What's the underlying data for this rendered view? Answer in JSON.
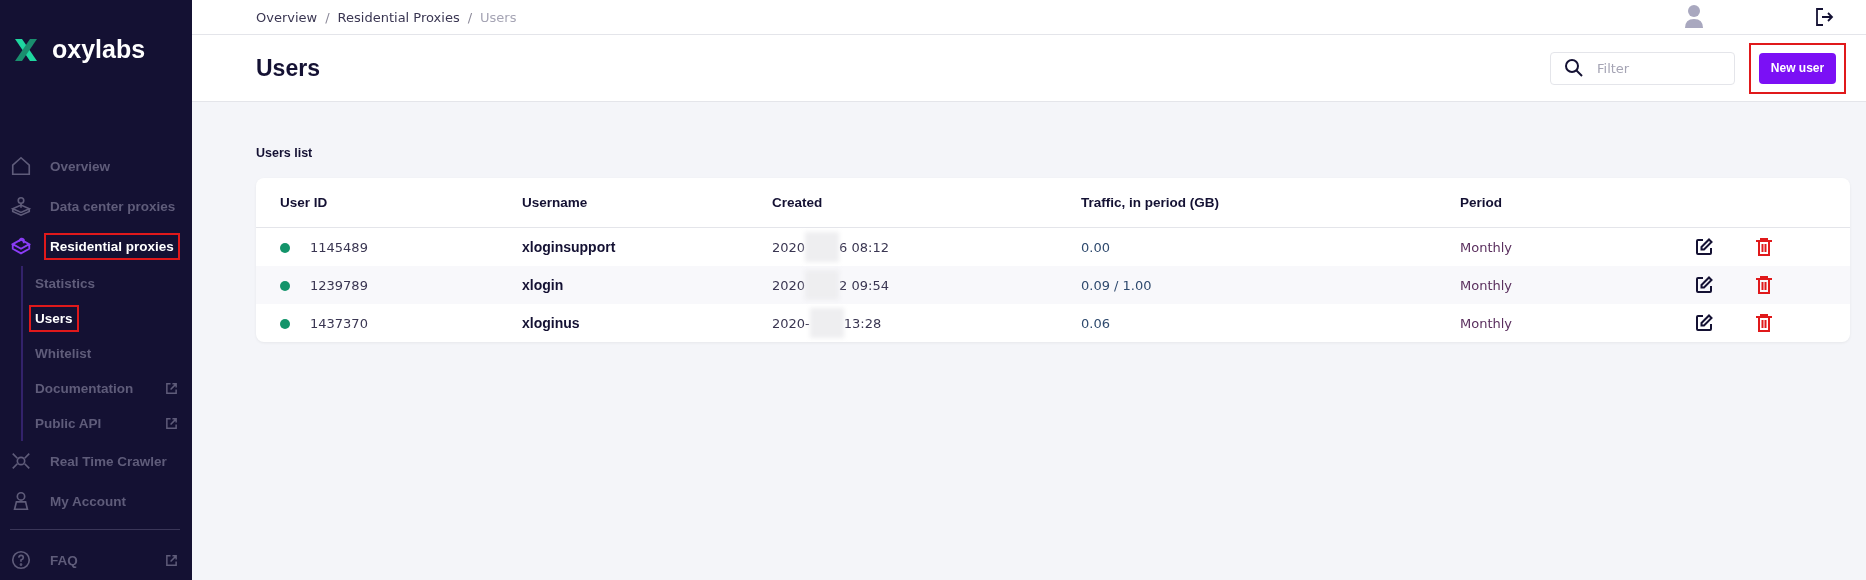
{
  "logo": {
    "text": "oxylabs"
  },
  "sidebar": {
    "items": [
      {
        "label": "Overview",
        "kind": "home",
        "selected": false,
        "highlighted": false,
        "external": false
      },
      {
        "label": "Data center proxies",
        "kind": "datacenter",
        "selected": false,
        "highlighted": false,
        "external": false
      },
      {
        "label": "Residential proxies",
        "kind": "residential",
        "selected": true,
        "highlighted": true,
        "external": false,
        "children": [
          {
            "label": "Statistics",
            "selected": false,
            "highlighted": false,
            "external": false
          },
          {
            "label": "Users",
            "selected": true,
            "highlighted": true,
            "external": false
          },
          {
            "label": "Whitelist",
            "selected": false,
            "highlighted": false,
            "external": false
          },
          {
            "label": "Documentation",
            "selected": false,
            "highlighted": false,
            "external": true
          },
          {
            "label": "Public API",
            "selected": false,
            "highlighted": false,
            "external": true
          }
        ]
      },
      {
        "label": "Real Time Crawler",
        "kind": "crawler",
        "selected": false,
        "highlighted": false,
        "external": false
      },
      {
        "label": "My Account",
        "kind": "account",
        "selected": false,
        "highlighted": false,
        "external": false
      }
    ],
    "footer_items": [
      {
        "label": "FAQ",
        "kind": "help",
        "selected": false,
        "highlighted": false,
        "external": true
      }
    ]
  },
  "breadcrumbs": [
    "Overview",
    "Residential Proxies",
    "Users"
  ],
  "breadcrumb_separator": "/",
  "page_title": "Users",
  "filter": {
    "placeholder": "Filter"
  },
  "new_user_button": {
    "label": "New user",
    "highlighted": true
  },
  "section_title": "Users list",
  "table": {
    "columns": [
      "User ID",
      "Username",
      "Created",
      "Traffic, in period (GB)",
      "Period"
    ],
    "rows": [
      {
        "active": true,
        "user_id": "1145489",
        "username": "xloginsupport",
        "created_start": "2020",
        "created_end": "6 08:12",
        "traffic": "0.00",
        "period": "Monthly"
      },
      {
        "active": true,
        "user_id": "1239789",
        "username": "xlogin",
        "created_start": "2020",
        "created_end": "2 09:54",
        "traffic": "0.09 / 1.00",
        "period": "Monthly"
      },
      {
        "active": true,
        "user_id": "1437370",
        "username": "xloginus",
        "created_start": "2020-",
        "created_end": "13:28",
        "traffic": "0.06",
        "period": "Monthly"
      }
    ]
  }
}
